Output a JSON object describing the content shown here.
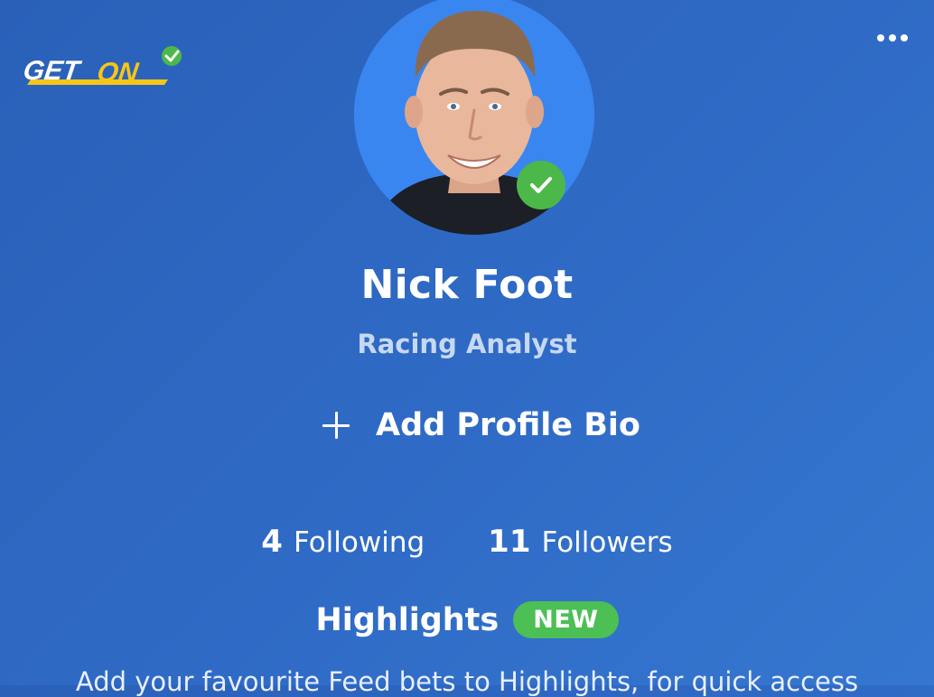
{
  "app": {
    "logo_text": "GETON",
    "brand_colors": {
      "primary_bg": "#2f6bc6",
      "logo_blue": "#ffffff",
      "logo_yellow": "#f5c518",
      "verified_green": "#4cb84a",
      "new_badge_green": "#4cbf55"
    }
  },
  "header": {
    "more_icon": "more-horizontal-icon"
  },
  "profile": {
    "name": "Nick Foot",
    "role": "Racing Analyst",
    "verified_icon": "check-circle-icon",
    "add_bio_label": "Add Profile Bio",
    "add_bio_icon": "plus-icon"
  },
  "stats": {
    "following_count": "4",
    "following_label": "Following",
    "followers_count": "11",
    "followers_label": "Followers"
  },
  "highlights": {
    "title": "Highlights",
    "badge": "NEW",
    "description": "Add your favourite Feed bets to Highlights, for quick access"
  }
}
